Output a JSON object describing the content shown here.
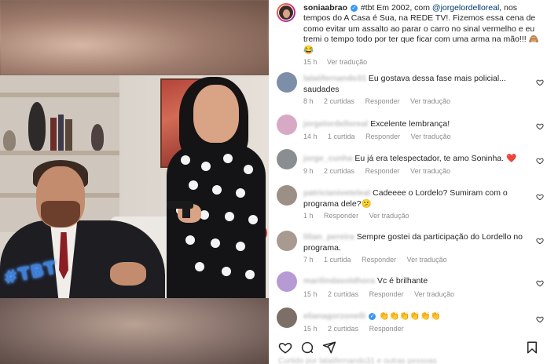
{
  "post": {
    "username": "soniaabrao",
    "caption_prefix": "#tbt Em 2002, com ",
    "mention": "@jorgelordelloreal",
    "caption_rest": ", nos tempos do A Casa é Sua, na REDE TV!. Fizemos essa cena de como evitar um assalto ao parar o carro no sinal vermelho e eu tremi o tempo todo por ter que ficar com uma arma na mão!!! 🙈😂",
    "time": "15 h",
    "see_translation": "Ver tradução",
    "media_overlay_text": "#TBT"
  },
  "comments": [
    {
      "user": "lalaiifernando31",
      "text": "Eu gostava dessa fase mais policial... saudades",
      "time": "8 h",
      "likes": "2 curtidas",
      "reply": "Responder",
      "translate": "Ver tradução",
      "avatar_color": "#7d8fa8"
    },
    {
      "user": "jorgelordelloreal",
      "text": "Excelente lembrança!",
      "time": "14 h",
      "likes": "1 curtida",
      "reply": "Responder",
      "translate": "Ver tradução",
      "avatar_color": "#d7a9c4"
    },
    {
      "user": "jorge_cunha",
      "text": "Eu já era telespectador, te amo Soninha. ❤️",
      "time": "9 h",
      "likes": "2 curtidas",
      "reply": "Responder",
      "translate": "Ver tradução",
      "avatar_color": "#8a8d92"
    },
    {
      "user": "patricianiveteleal",
      "text": "Cadeeee o Lordelo? Sumiram com o programa dele?😕",
      "time": "1 h",
      "likes": "",
      "reply": "Responder",
      "translate": "Ver tradução",
      "avatar_color": "#9c8f86"
    },
    {
      "user": "lilian_pereira",
      "text": "Sempre gostei da participação do Lordello no programa.",
      "time": "7 h",
      "likes": "1 curtida",
      "reply": "Responder",
      "translate": "Ver tradução",
      "avatar_color": "#a89a90"
    },
    {
      "user": "marilindasoldhora",
      "text": "Vc é brilhante",
      "time": "15 h",
      "likes": "2 curtidas",
      "reply": "Responder",
      "translate": "Ver tradução",
      "avatar_color": "#b59ad4"
    },
    {
      "user": "elianagorzonelli",
      "text": "👏👏👏👏👏👏",
      "time": "15 h",
      "likes": "2 curtidas",
      "reply": "Responder",
      "translate": "",
      "avatar_color": "#7b6f68"
    }
  ],
  "bottom": {
    "likes_peek": "Curtido por lalaiifernando31 e outras pessoas"
  },
  "icons": [
    "heart-icon",
    "comment-icon",
    "share-icon",
    "save-icon",
    "verified-icon"
  ]
}
